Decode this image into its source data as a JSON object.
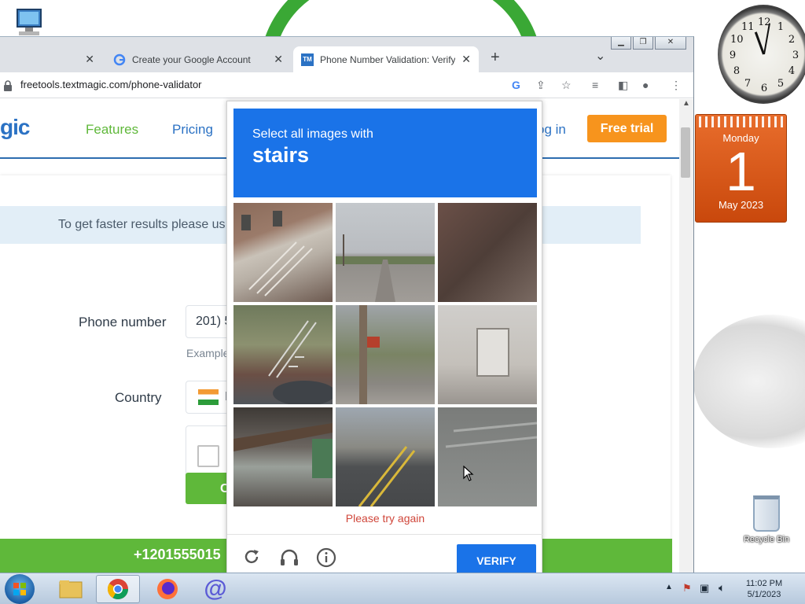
{
  "browser": {
    "tabs": [
      {
        "label": "",
        "close": "✕"
      },
      {
        "label": "Create your Google Account",
        "close": "✕"
      },
      {
        "label": "Phone Number Validation: Verify",
        "close": "✕"
      }
    ],
    "new_tab": "+",
    "tab_menu": "⌄",
    "url": "freetools.textmagic.com/phone-validator"
  },
  "site": {
    "logo": "gic",
    "nav": [
      {
        "label": "Features",
        "color": "#5fb83a"
      },
      {
        "label": "Pricing",
        "color": "#2b72c4"
      }
    ],
    "login": "og in",
    "free_trial": "Free trial",
    "info_text": "To get faster results please us",
    "phone_label": "Phone number",
    "phone_value": "201) 5",
    "example": "Example",
    "country_label": "Country",
    "country_code": "I",
    "green_button": "C",
    "green_number": "+1201555015"
  },
  "captcha": {
    "instruction": "Select all images with",
    "target": "stairs",
    "error": "Please try again",
    "verify": "VERIFY",
    "accent": "#1a73e8"
  },
  "desktop": {
    "calendar_day": "Monday",
    "calendar_date": "1",
    "calendar_month": "May 2023",
    "recycle_bin": "Recycle Bin"
  },
  "taskbar": {
    "time": "11:02 PM",
    "date": "5/1/2023"
  }
}
